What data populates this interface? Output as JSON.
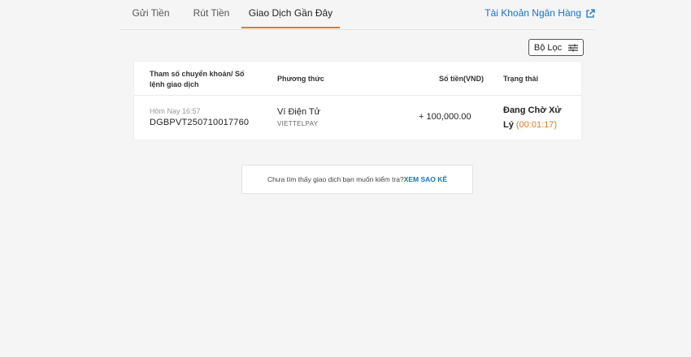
{
  "tabs": [
    {
      "label": "Gửi Tiền"
    },
    {
      "label": "Rút Tiền"
    },
    {
      "label": "Giao Dịch Gần Đây"
    }
  ],
  "bank_link": {
    "label": "Tài Khoản Ngân Hàng",
    "icon": "external-link-icon"
  },
  "filter": {
    "label": "Bộ Lọc",
    "icon": "filter-icon"
  },
  "table": {
    "headers": {
      "ref_line1": "Tham số chuyển khoản/ Số",
      "ref_line2": "lệnh giao dịch",
      "method": "Phương thức",
      "amount": "Số tiền(VND)",
      "status": "Trạng thái"
    },
    "rows": [
      {
        "time": "Hôm Nay 16:57",
        "ref": "DGBPVT250710017760",
        "method": "Ví Điện Tử",
        "method_sub": "VIETTELPAY",
        "amount": "+ 100,000.00",
        "status_line1": "Đang Chờ Xử",
        "status_line2": "Lý",
        "timer": "(00:01:17)"
      }
    ]
  },
  "notice": {
    "text": "Chưa tìm thấy giao dịch bạn muốn kiểm tra?",
    "link": "XEM SAO KÊ"
  },
  "colors": {
    "accent": "#e07b1f",
    "link": "#1a73c8"
  }
}
